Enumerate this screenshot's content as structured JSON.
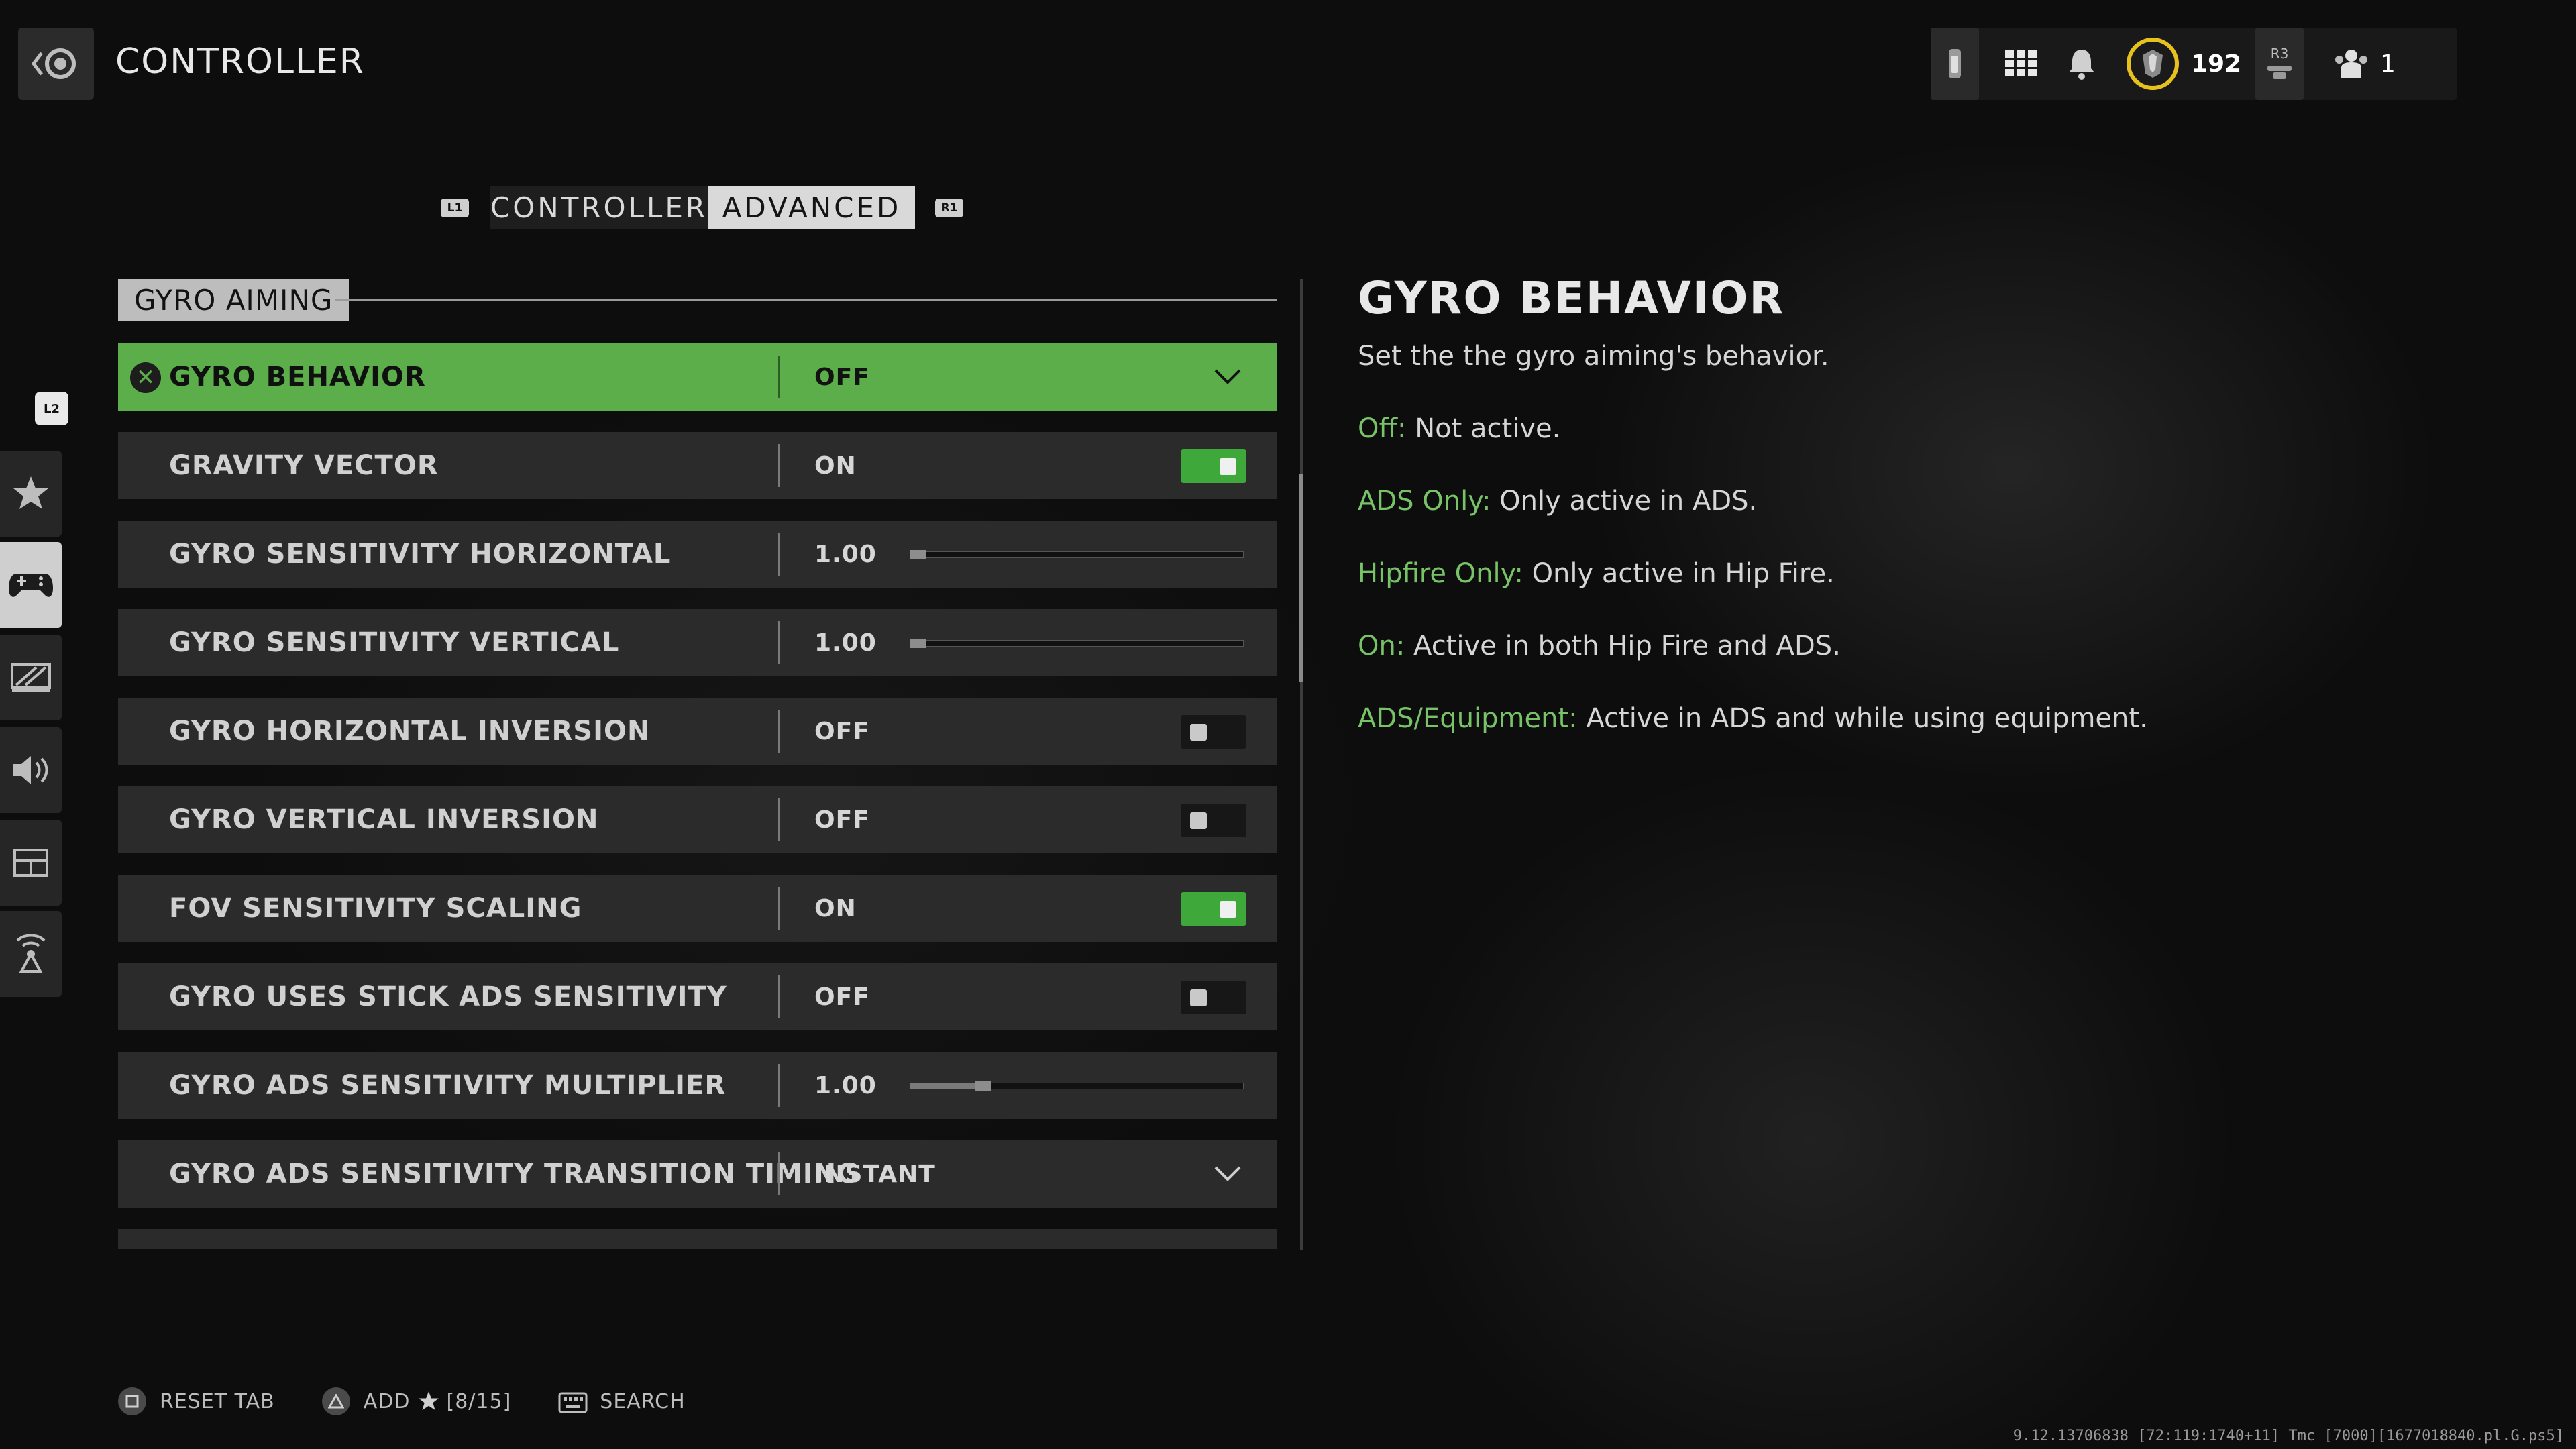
{
  "header": {
    "title": "CONTROLLER",
    "currency_count": "192",
    "r3_label": "R3",
    "party_count": "1"
  },
  "tabs": {
    "left_bumper": "L1",
    "right_bumper": "R1",
    "items": [
      {
        "label": "CONTROLLER",
        "active": false
      },
      {
        "label": "ADVANCED",
        "active": true
      }
    ]
  },
  "rail": {
    "l2_label": "L2",
    "items": [
      "favorites",
      "controller",
      "graphics",
      "audio",
      "interface",
      "network"
    ],
    "active": "controller"
  },
  "section": {
    "title": "GYRO AIMING"
  },
  "settings": [
    {
      "label": "GYRO BEHAVIOR",
      "value": "OFF",
      "type": "dropdown",
      "selected": true
    },
    {
      "label": "GRAVITY VECTOR",
      "value": "ON",
      "type": "toggle",
      "state": "on"
    },
    {
      "label": "GYRO SENSITIVITY HORIZONTAL",
      "value": "1.00",
      "type": "slider",
      "level": 0.02
    },
    {
      "label": "GYRO SENSITIVITY VERTICAL",
      "value": "1.00",
      "type": "slider",
      "level": 0.02
    },
    {
      "label": "GYRO HORIZONTAL INVERSION",
      "value": "OFF",
      "type": "toggle",
      "state": "off"
    },
    {
      "label": "GYRO VERTICAL INVERSION",
      "value": "OFF",
      "type": "toggle",
      "state": "off"
    },
    {
      "label": "FOV SENSITIVITY SCALING",
      "value": "ON",
      "type": "toggle",
      "state": "on"
    },
    {
      "label": "GYRO USES STICK ADS SENSITIVITY",
      "value": "OFF",
      "type": "toggle",
      "state": "off"
    },
    {
      "label": "GYRO ADS SENSITIVITY MULTIPLIER",
      "value": "1.00",
      "type": "slider",
      "level": 0.22
    },
    {
      "label": "GYRO ADS SENSITIVITY TRANSITION TIMING",
      "value": "INSTANT",
      "type": "dropdown"
    }
  ],
  "description": {
    "title": "GYRO BEHAVIOR",
    "subtitle": "Set the the gyro aiming's behavior.",
    "options": [
      {
        "key": "Off:",
        "text": " Not active."
      },
      {
        "key": "ADS Only:",
        "text": " Only active in ADS."
      },
      {
        "key": "Hipfire Only:",
        "text": " Only active in Hip Fire."
      },
      {
        "key": "On:",
        "text": " Active in both Hip Fire and ADS."
      },
      {
        "key": "ADS/Equipment:",
        "text": " Active in ADS and while using equipment."
      }
    ]
  },
  "footer": {
    "reset": "RESET TAB",
    "add": "ADD",
    "add_count": "[8/15]",
    "search": "SEARCH"
  },
  "build_string": "9.12.13706838 [72:119:1740+11] Tmc [7000][1677018840.pl.G.ps5]",
  "colors": {
    "accent_green": "#5bae4a",
    "toggle_on": "#3ea83a",
    "desc_key": "#78c268",
    "currency_ring": "#e8c21c"
  }
}
